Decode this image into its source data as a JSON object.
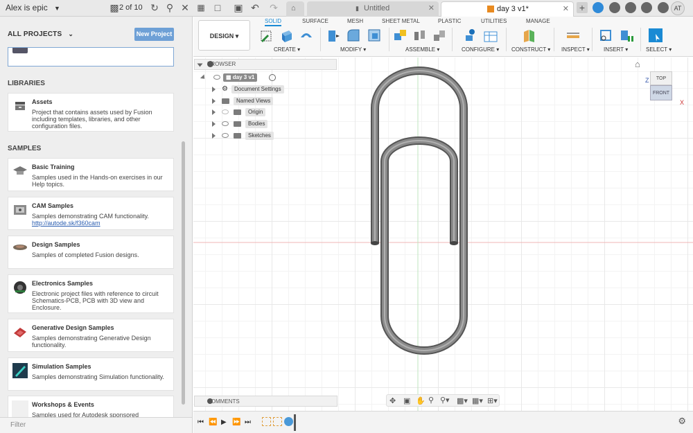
{
  "topbar": {
    "user_label": "Alex is epic",
    "doc_count": "2 of 10",
    "tabs": [
      {
        "label": "Untitled"
      },
      {
        "label": "day 3 v1*"
      }
    ],
    "avatar_initials": "AT"
  },
  "left_panel": {
    "header": "ALL PROJECTS",
    "new_project_label": "New Project",
    "libraries_heading": "LIBRARIES",
    "samples_heading": "SAMPLES",
    "filter_placeholder": "Filter",
    "libraries": [
      {
        "title": "Assets",
        "desc": "Project that contains assets used by Fusion including templates, libraries, and other configuration files."
      }
    ],
    "samples": [
      {
        "title": "Basic Training",
        "desc": "Samples used in the Hands-on exercises in our Help topics."
      },
      {
        "title": "CAM Samples",
        "desc": "Samples demonstrating CAM functionality.",
        "link": "http://autode.sk/f360cam"
      },
      {
        "title": "Design Samples",
        "desc": "Samples of completed Fusion designs."
      },
      {
        "title": "Electronics Samples",
        "desc": "Electronic project files with reference to circuit Schematics-PCB, PCB with 3D view and Enclosure."
      },
      {
        "title": "Generative Design Samples",
        "desc": "Samples demonstrating Generative Design functionality."
      },
      {
        "title": "Simulation Samples",
        "desc": "Samples demonstrating Simulation functionality."
      },
      {
        "title": "Workshops & Events",
        "desc": "Samples used for Autodesk sponsored"
      }
    ]
  },
  "toolbar": {
    "design_label": "DESIGN",
    "workspace_tabs": [
      "SOLID",
      "SURFACE",
      "MESH",
      "SHEET METAL",
      "PLASTIC",
      "UTILITIES",
      "MANAGE"
    ],
    "active_tab": "SOLID",
    "groups": [
      "CREATE",
      "MODIFY",
      "ASSEMBLE",
      "CONFIGURE",
      "CONSTRUCT",
      "INSPECT",
      "INSERT",
      "SELECT"
    ]
  },
  "browser": {
    "title": "BROWSER",
    "root": "day 3 v1",
    "items": [
      "Document Settings",
      "Named Views",
      "Origin",
      "Bodies",
      "Sketches"
    ]
  },
  "viewcube": {
    "top": "TOP",
    "front": "FRONT",
    "axis_z": "Z",
    "axis_x": "X"
  },
  "comments_label": "COMMENTS",
  "colors": {
    "accent": "#1a8ad4",
    "new_project": "#6ea0d6",
    "x_axis": "#e8a0a0",
    "y_axis": "#b8e0b8",
    "paperclip": "#6f6f6f"
  }
}
